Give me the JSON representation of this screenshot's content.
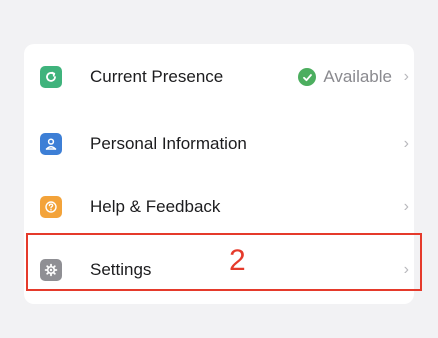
{
  "menu": {
    "items": [
      {
        "label": "Current Presence",
        "icon": "presence-icon",
        "icon_color": "#3fb37c",
        "status": "Available",
        "status_color": "#4cae5f"
      },
      {
        "label": "Personal Information",
        "icon": "person-icon",
        "icon_color": "#3d7fd6"
      },
      {
        "label": "Help & Feedback",
        "icon": "help-icon",
        "icon_color": "#f3a33a"
      },
      {
        "label": "Settings",
        "icon": "gear-icon",
        "icon_color": "#8f8f94"
      }
    ],
    "chevron": "›"
  },
  "annotation": {
    "number": "2",
    "color": "#e53a2b"
  }
}
